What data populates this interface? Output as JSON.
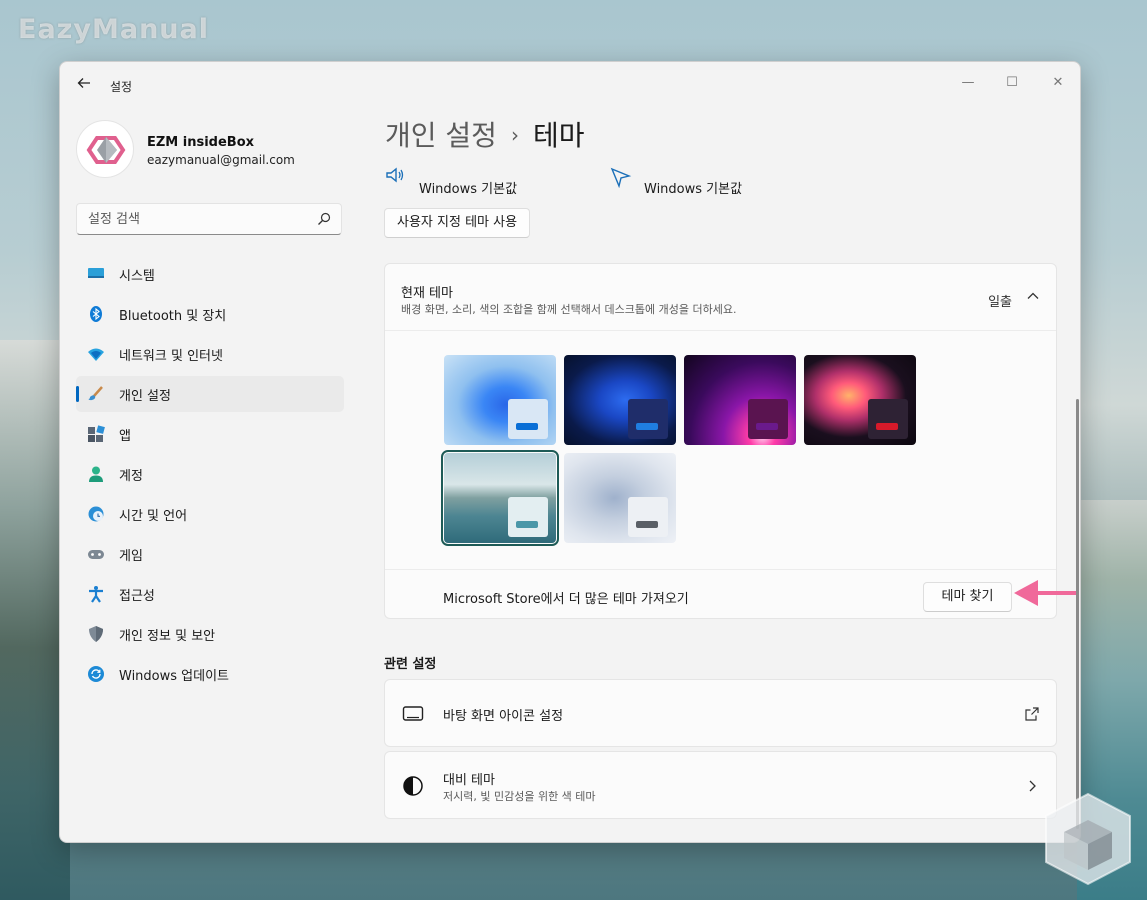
{
  "watermark": {
    "text": "EazyManual"
  },
  "window": {
    "app_title": "설정",
    "controls": {
      "minimize": "—",
      "maximize": "☐",
      "close": "✕"
    }
  },
  "profile": {
    "name": "EZM insideBox",
    "email": "eazymanual@gmail.com"
  },
  "search": {
    "placeholder": "설정 검색"
  },
  "sidebar": {
    "items": [
      {
        "label": "시스템",
        "icon": "system-icon"
      },
      {
        "label": "Bluetooth 및 장치",
        "icon": "bluetooth-icon"
      },
      {
        "label": "네트워크 및 인터넷",
        "icon": "network-icon"
      },
      {
        "label": "개인 설정",
        "icon": "personalization-icon",
        "selected": true
      },
      {
        "label": "앱",
        "icon": "apps-icon"
      },
      {
        "label": "계정",
        "icon": "accounts-icon"
      },
      {
        "label": "시간 및 언어",
        "icon": "time-language-icon"
      },
      {
        "label": "게임",
        "icon": "gaming-icon"
      },
      {
        "label": "접근성",
        "icon": "accessibility-icon"
      },
      {
        "label": "개인 정보 및 보안",
        "icon": "privacy-shield-icon"
      },
      {
        "label": "Windows 업데이트",
        "icon": "windows-update-icon"
      }
    ]
  },
  "breadcrumb": {
    "parent": "개인 설정",
    "separator": "›",
    "current": "테마"
  },
  "theme_settings": {
    "sound": {
      "label_partial": "소리",
      "value": "Windows 기본값"
    },
    "cursor": {
      "label_partial": "마우스 커서",
      "value": "Windows 기본값"
    },
    "custom_theme_button": "사용자 지정 테마 사용"
  },
  "current_theme": {
    "title": "현재 테마",
    "description": "배경 화면, 소리, 색의 조합을 함께 선택해서 데스크톱에 개성을 더하세요.",
    "current_value": "일출",
    "themes": [
      {
        "accent": "#0a6fd6",
        "window_bg": "#cfe0f5"
      },
      {
        "accent": "#1f7de0",
        "window_bg": "#1e2f6e"
      },
      {
        "accent": "#6a1a8c",
        "window_bg": "#5a1450"
      },
      {
        "accent": "#d61a2a",
        "window_bg": "#2a2030"
      },
      {
        "accent": "#4a97a8",
        "window_bg": "#dfe9ec",
        "selected": true
      },
      {
        "accent": "#5a5f66",
        "window_bg": "#e8ebef"
      }
    ]
  },
  "store": {
    "text": "Microsoft Store에서 더 많은 테마 가져오기",
    "button": "테마 찾기",
    "highlight_color": "#f0699a"
  },
  "related": {
    "title": "관련 설정",
    "items": [
      {
        "label": "바탕 화면 아이콘 설정",
        "icon": "desktop-monitor-icon",
        "end_icon": "external-link-icon"
      },
      {
        "label": "대비 테마",
        "sub": "저시력, 빛 민감성을 위한 색 테마",
        "icon": "contrast-icon",
        "end_icon": "chevron-right-icon"
      }
    ]
  }
}
